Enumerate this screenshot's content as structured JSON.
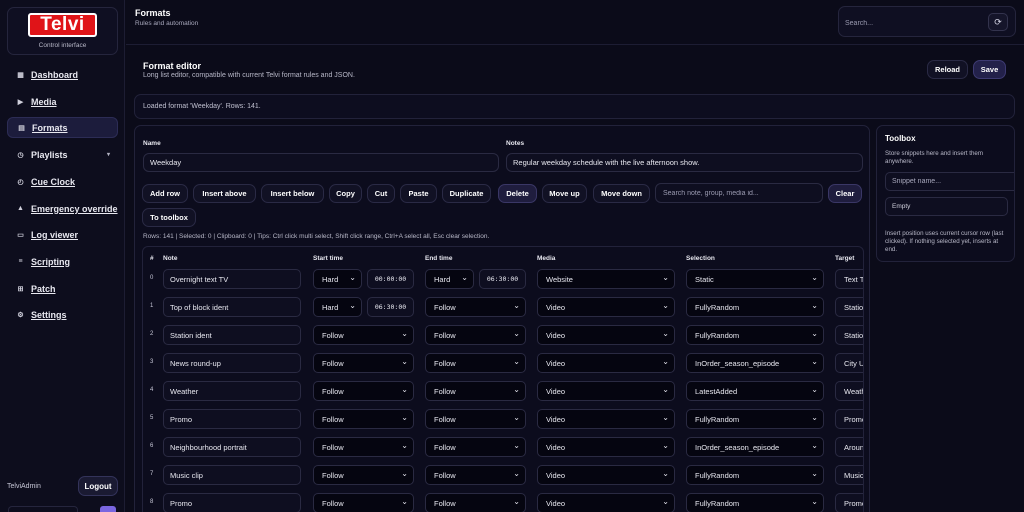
{
  "brand": {
    "logo": "Telvi",
    "subtitle": "Control interface"
  },
  "nav": [
    {
      "label": "Dashboard",
      "icon": "grid-icon",
      "glyph": "▦"
    },
    {
      "label": "Media",
      "icon": "play-icon",
      "glyph": "▶"
    },
    {
      "label": "Formats",
      "icon": "format-icon",
      "glyph": "▤"
    },
    {
      "label": "Playlists",
      "icon": "clock-icon",
      "glyph": "◷"
    },
    {
      "label": "Cue Clock",
      "icon": "cue-clock-icon",
      "glyph": "◴"
    },
    {
      "label": "Emergency override",
      "icon": "warning-icon",
      "glyph": "▲"
    },
    {
      "label": "Log viewer",
      "icon": "log-icon",
      "glyph": "▭"
    },
    {
      "label": "Scripting",
      "icon": "script-icon",
      "glyph": "≡"
    },
    {
      "label": "Patch",
      "icon": "patch-icon",
      "glyph": "⊞"
    },
    {
      "label": "Settings",
      "icon": "gear-icon",
      "glyph": "⚙"
    }
  ],
  "user": {
    "name": "TelviAdmin",
    "logout_label": "Logout"
  },
  "header": {
    "title": "Formats",
    "subtitle": "Rules and automation",
    "search_placeholder": "Search...",
    "refresh_glyph": "⟳"
  },
  "editor": {
    "title": "Format editor",
    "subtitle": "Long list editor, compatible with current Telvi format rules and JSON.",
    "reload_label": "Reload",
    "save_label": "Save",
    "status": "Loaded format 'Weekday'. Rows: 141.",
    "name_label": "Name",
    "name_value": "Weekday",
    "notes_label": "Notes",
    "notes_value": "Regular weekday schedule with the live afternoon show.",
    "toolbar": {
      "add_row": "Add row",
      "insert_above": "Insert above",
      "insert_below": "Insert below",
      "copy": "Copy",
      "cut": "Cut",
      "paste": "Paste",
      "duplicate": "Duplicate",
      "delete": "Delete",
      "move_up": "Move up",
      "move_down": "Move down",
      "filter_placeholder": "Search note, group, media id...",
      "clear": "Clear",
      "to_toolbox": "To toolbox"
    },
    "rows_info": "Rows: 141 | Selected: 0 | Clipboard: 0 | Tips: Ctrl click multi select, Shift click range, Ctrl+A select all, Esc clear selection."
  },
  "table": {
    "headers": {
      "num": "#",
      "note": "Note",
      "start": "Start time",
      "end": "End time",
      "media": "Media",
      "selection": "Selection",
      "target": "Target"
    },
    "rows": [
      {
        "num": "0",
        "note": "Overnight text TV",
        "start_mode": "Hard",
        "start_time": "00:00:00",
        "end_mode": "Hard",
        "end_time": "06:30:00",
        "media": "Website",
        "selection": "Static",
        "target": "Text TV"
      },
      {
        "num": "1",
        "note": "Top of block ident",
        "start_mode": "Hard",
        "start_time": "06:30:00",
        "end_mode": "Follow",
        "media": "Video",
        "selection": "FullyRandom",
        "target": "Station"
      },
      {
        "num": "2",
        "note": "Station ident",
        "start_mode": "Follow",
        "end_mode": "Follow",
        "media": "Video",
        "selection": "FullyRandom",
        "target": "Station"
      },
      {
        "num": "3",
        "note": "News round-up",
        "start_mode": "Follow",
        "end_mode": "Follow",
        "media": "Video",
        "selection": "InOrder_season_episode",
        "target": "City U"
      },
      {
        "num": "4",
        "note": "Weather",
        "start_mode": "Follow",
        "end_mode": "Follow",
        "media": "Video",
        "selection": "LatestAdded",
        "target": "Weath"
      },
      {
        "num": "5",
        "note": "Promo",
        "start_mode": "Follow",
        "end_mode": "Follow",
        "media": "Video",
        "selection": "FullyRandom",
        "target": "Promo"
      },
      {
        "num": "6",
        "note": "Neighbourhood portrait",
        "start_mode": "Follow",
        "end_mode": "Follow",
        "media": "Video",
        "selection": "InOrder_season_episode",
        "target": "Aroun"
      },
      {
        "num": "7",
        "note": "Music clip",
        "start_mode": "Follow",
        "end_mode": "Follow",
        "media": "Video",
        "selection": "FullyRandom",
        "target": "Music"
      },
      {
        "num": "8",
        "note": "Promo",
        "start_mode": "Follow",
        "end_mode": "Follow",
        "media": "Video",
        "selection": "FullyRandom",
        "target": "Promo"
      }
    ]
  },
  "toolbox": {
    "title": "Toolbox",
    "description": "Store snippets here and insert them anywhere.",
    "snippet_placeholder": "Snippet name...",
    "empty_label": "Empty",
    "note": "Insert position uses current cursor row (last clicked). If nothing selected yet, inserts at end."
  }
}
